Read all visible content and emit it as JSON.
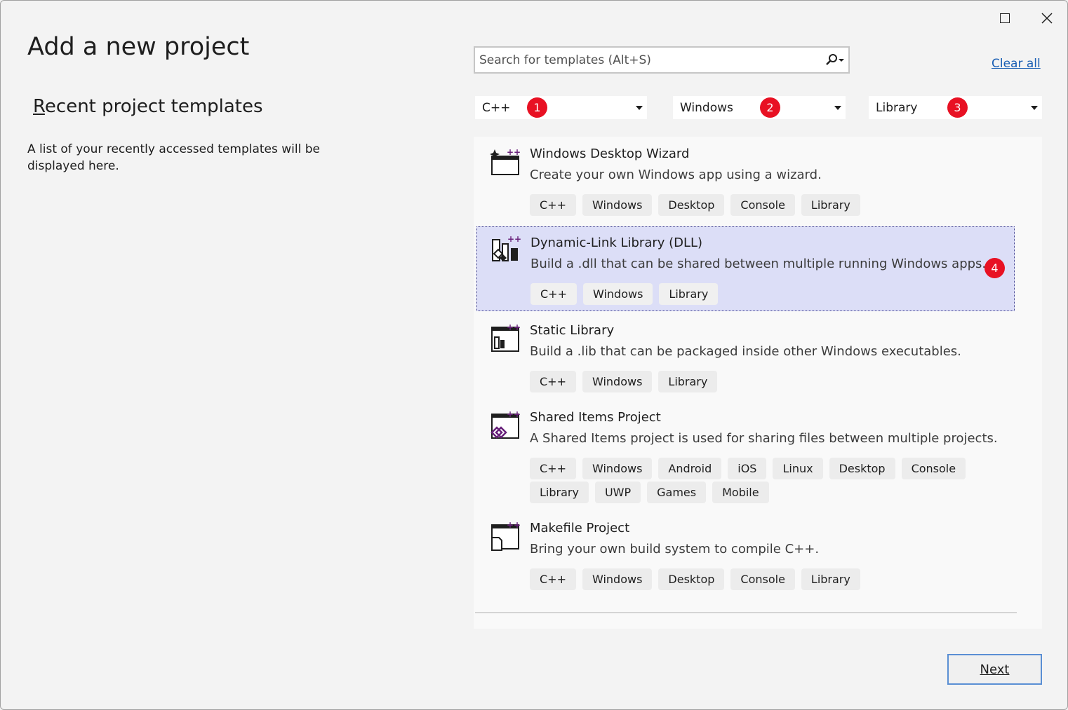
{
  "page": {
    "title": "Add a new project",
    "recent_heading": "Recent project templates",
    "recent_heading_first": "R",
    "recent_heading_rest": "ecent project templates",
    "recent_description": "A list of your recently accessed templates will be displayed here."
  },
  "search": {
    "placeholder": "Search for templates (Alt+S)",
    "clear_all": "Clear all"
  },
  "filters": [
    {
      "label": "C++",
      "badge": "1"
    },
    {
      "label": "Windows",
      "badge": "2"
    },
    {
      "label": "Library",
      "badge": "3"
    }
  ],
  "templates": [
    {
      "name": "Windows Desktop Wizard",
      "description": "Create your own Windows app using a wizard.",
      "tags": [
        "C++",
        "Windows",
        "Desktop",
        "Console",
        "Library"
      ],
      "icon": "wizard-icon"
    },
    {
      "name": "Dynamic-Link Library (DLL)",
      "description": "Build a .dll that can be shared between multiple running Windows apps.",
      "tags": [
        "C++",
        "Windows",
        "Library"
      ],
      "icon": "dll-icon",
      "selected": true,
      "badge": "4"
    },
    {
      "name": "Static Library",
      "description": "Build a .lib that can be packaged inside other Windows executables.",
      "tags": [
        "C++",
        "Windows",
        "Library"
      ],
      "icon": "static-library-icon"
    },
    {
      "name": "Shared Items Project",
      "description": "A Shared Items project is used for sharing files between multiple projects.",
      "tags": [
        "C++",
        "Windows",
        "Android",
        "iOS",
        "Linux",
        "Desktop",
        "Console",
        "Library",
        "UWP",
        "Games",
        "Mobile"
      ],
      "icon": "shared-items-icon"
    },
    {
      "name": "Makefile Project",
      "description": "Bring your own build system to compile C++.",
      "tags": [
        "C++",
        "Windows",
        "Desktop",
        "Console",
        "Library"
      ],
      "icon": "makefile-icon"
    }
  ],
  "footer": {
    "next_label": "Next"
  },
  "colors": {
    "accent_link": "#1a5fb4",
    "badge": "#e81123",
    "selected_bg": "#dcdef7",
    "cpp_plus": "#68217a"
  }
}
